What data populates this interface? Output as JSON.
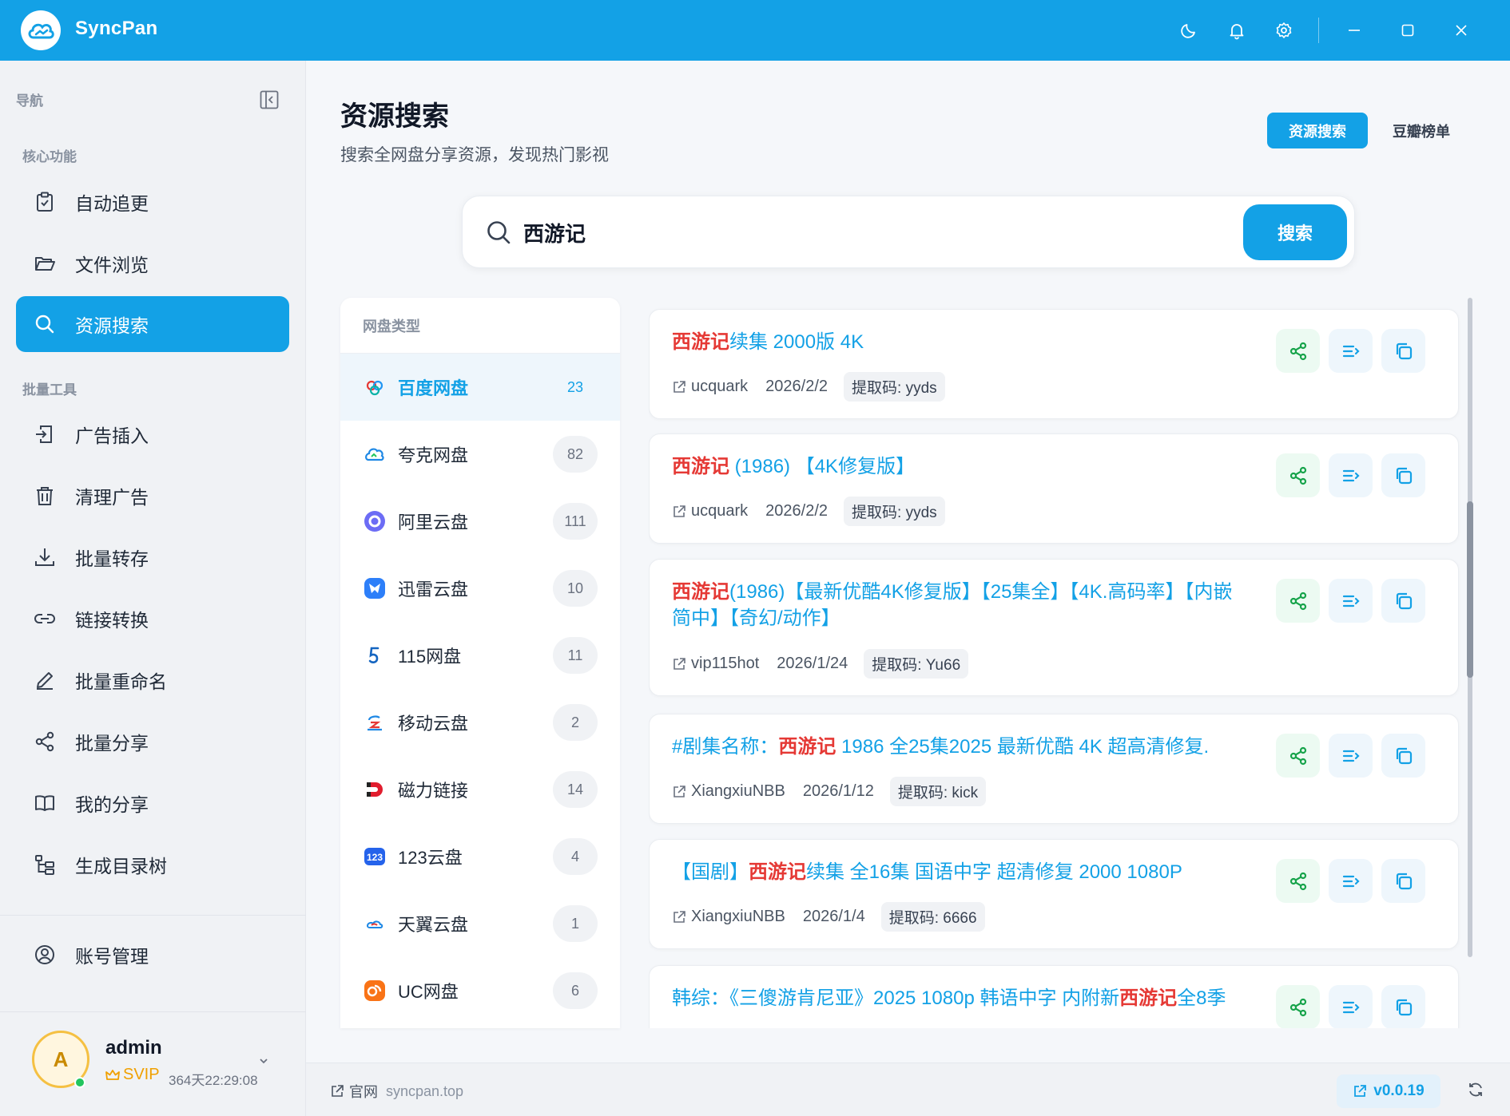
{
  "app": {
    "name": "SyncPan",
    "accent": "#13a1e6"
  },
  "titlebar": {
    "icons": [
      "moon-icon",
      "bell-icon",
      "gear-icon",
      "minimize-icon",
      "maximize-icon",
      "close-icon"
    ]
  },
  "sidebar": {
    "nav_header": "导航",
    "sections": [
      {
        "title": "核心功能",
        "items": [
          {
            "label": "自动追更",
            "icon": "clipboard-check-icon",
            "active": false
          },
          {
            "label": "文件浏览",
            "icon": "folder-open-icon",
            "active": false
          },
          {
            "label": "资源搜索",
            "icon": "search-icon",
            "active": true
          }
        ]
      },
      {
        "title": "批量工具",
        "items": [
          {
            "label": "广告插入",
            "icon": "file-insert-icon",
            "active": false
          },
          {
            "label": "清理广告",
            "icon": "trash-icon",
            "active": false
          },
          {
            "label": "批量转存",
            "icon": "download-icon",
            "active": false
          },
          {
            "label": "链接转换",
            "icon": "link-icon",
            "active": false
          },
          {
            "label": "批量重命名",
            "icon": "pen-icon",
            "active": false
          },
          {
            "label": "批量分享",
            "icon": "share-icon",
            "active": false
          },
          {
            "label": "我的分享",
            "icon": "book-icon",
            "active": false
          },
          {
            "label": "生成目录树",
            "icon": "tree-icon",
            "active": false
          }
        ]
      }
    ],
    "account_item": {
      "label": "账号管理",
      "icon": "user-circle-icon"
    },
    "user": {
      "avatar_letter": "A",
      "name": "admin",
      "tier": "SVIP",
      "expire": "364天22:29:08"
    }
  },
  "main": {
    "title": "资源搜索",
    "subtitle": "搜索全网盘分享资源，发现热门影视",
    "tabs": [
      {
        "label": "资源搜索",
        "active": true
      },
      {
        "label": "豆瓣榜单",
        "active": false
      }
    ],
    "search": {
      "value": "西游记",
      "button": "搜索"
    },
    "provider_panel": {
      "title": "网盘类型",
      "providers": [
        {
          "name": "百度网盘",
          "count": "23",
          "active": true,
          "icon": "baidu-icon"
        },
        {
          "name": "夸克网盘",
          "count": "82",
          "active": false,
          "icon": "quark-icon"
        },
        {
          "name": "阿里云盘",
          "count": "111",
          "active": false,
          "icon": "aliyun-icon"
        },
        {
          "name": "迅雷云盘",
          "count": "10",
          "active": false,
          "icon": "xunlei-icon"
        },
        {
          "name": "115网盘",
          "count": "11",
          "active": false,
          "icon": "115-icon"
        },
        {
          "name": "移动云盘",
          "count": "2",
          "active": false,
          "icon": "mobile-cloud-icon"
        },
        {
          "name": "磁力链接",
          "count": "14",
          "active": false,
          "icon": "magnet-icon"
        },
        {
          "name": "123云盘",
          "count": "4",
          "active": false,
          "icon": "123-icon"
        },
        {
          "name": "天翼云盘",
          "count": "1",
          "active": false,
          "icon": "tianyi-icon"
        },
        {
          "name": "UC网盘",
          "count": "6",
          "active": false,
          "icon": "uc-icon"
        }
      ]
    },
    "results": [
      {
        "title_parts": [
          {
            "text": "西游记",
            "hl": true
          },
          {
            "text": "续集 2000版 4K",
            "hl": false
          }
        ],
        "source": "ucquark",
        "date": "2026/2/2",
        "code": "提取码: yyds"
      },
      {
        "title_parts": [
          {
            "text": "西游记",
            "hl": true
          },
          {
            "text": " (1986) 【4K修复版】",
            "hl": false
          }
        ],
        "source": "ucquark",
        "date": "2026/2/2",
        "code": "提取码: yyds"
      },
      {
        "title_parts": [
          {
            "text": "西游记",
            "hl": true
          },
          {
            "text": "(1986)【最新优酷4K修复版】【25集全】【4K.高码率】【内嵌简中】【奇幻/动作】",
            "hl": false
          }
        ],
        "source": "vip115hot",
        "date": "2026/1/24",
        "code": "提取码: Yu66"
      },
      {
        "title_parts": [
          {
            "text": "#剧集名称：",
            "hl": false
          },
          {
            "text": "西游记",
            "hl": true
          },
          {
            "text": " 1986 全25集2025 最新优酷 4K 超高清修复.",
            "hl": false
          }
        ],
        "source": "XiangxiuNBB",
        "date": "2026/1/12",
        "code": "提取码: kick"
      },
      {
        "title_parts": [
          {
            "text": "【国剧】",
            "hl": false
          },
          {
            "text": "西游记",
            "hl": true
          },
          {
            "text": "续集 全16集 国语中字 超清修复 2000 1080P",
            "hl": false
          }
        ],
        "source": "XiangxiuNBB",
        "date": "2026/1/4",
        "code": "提取码: 6666"
      },
      {
        "title_parts": [
          {
            "text": "韩综：《三傻游肯尼亚》2025 1080p 韩语中字 内附新",
            "hl": false
          },
          {
            "text": "西游记",
            "hl": true
          },
          {
            "text": "全8季",
            "hl": false
          }
        ],
        "source": "",
        "date": "",
        "code": ""
      }
    ]
  },
  "footer": {
    "site_label": "官网",
    "site_url": "syncpan.top",
    "version": "v0.0.19"
  }
}
